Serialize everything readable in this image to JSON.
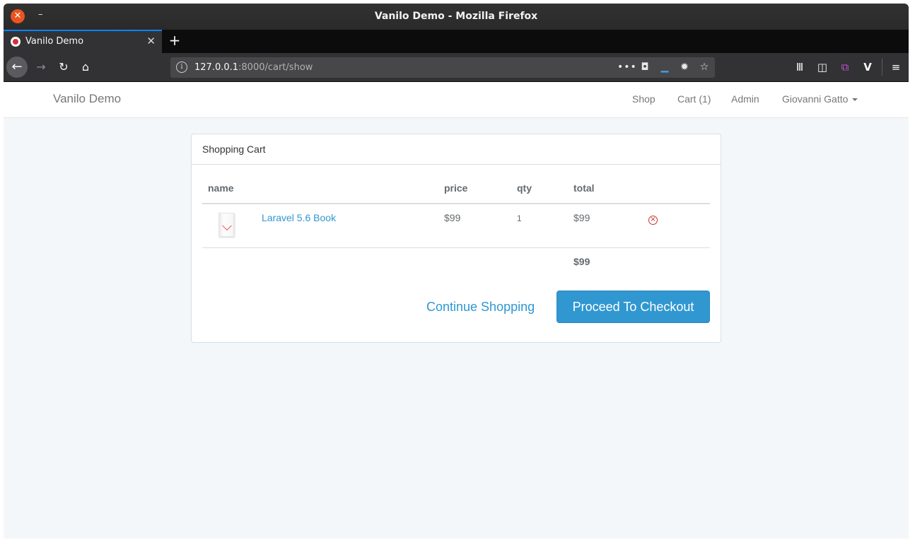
{
  "window": {
    "title": "Vanilo Demo - Mozilla Firefox",
    "close_glyph": "✕",
    "minimize_glyph": "–"
  },
  "tabs": [
    {
      "label": "Vanilo Demo",
      "close_glyph": "✕",
      "active": true
    }
  ],
  "new_tab_glyph": "+",
  "toolbar": {
    "back_glyph": "←",
    "forward_glyph": "→",
    "reload_glyph": "↻",
    "home_glyph": "⌂",
    "url_host": "127.0.0.1",
    "url_path": ":8000/cart/show",
    "page_actions_glyph": "•••",
    "pocket_glyph": "◘",
    "dash_glyph": "▁",
    "bug_glyph": "✹",
    "bookmark_glyph": "☆",
    "library_glyph": "Ⅲ",
    "sidebar_glyph": "◫",
    "containers_glyph": "⧉",
    "vanilo_ext_glyph": "V",
    "menu_glyph": "≡"
  },
  "site_nav": {
    "brand": "Vanilo Demo",
    "links": {
      "shop": "Shop",
      "cart": "Cart (1)",
      "admin": "Admin",
      "user": "Giovanni Gatto"
    }
  },
  "cart": {
    "heading": "Shopping Cart",
    "columns": {
      "name": "name",
      "price": "price",
      "qty": "qty",
      "total": "total"
    },
    "items": [
      {
        "name": "Laravel 5.6 Book",
        "price": "$99",
        "qty": "1",
        "total": "$99",
        "remove_glyph": "×"
      }
    ],
    "grand_total": "$99",
    "continue_label": "Continue Shopping",
    "checkout_label": "Proceed To Checkout"
  },
  "colors": {
    "accent": "#3097d1",
    "danger": "#c0392b",
    "page_bg": "#f4f7fa",
    "chrome_dark": "#323234"
  },
  "icons": {
    "remove": "remove-circle-icon",
    "caret": "caret-down-icon",
    "thumbnail": "book-thumbnail"
  }
}
